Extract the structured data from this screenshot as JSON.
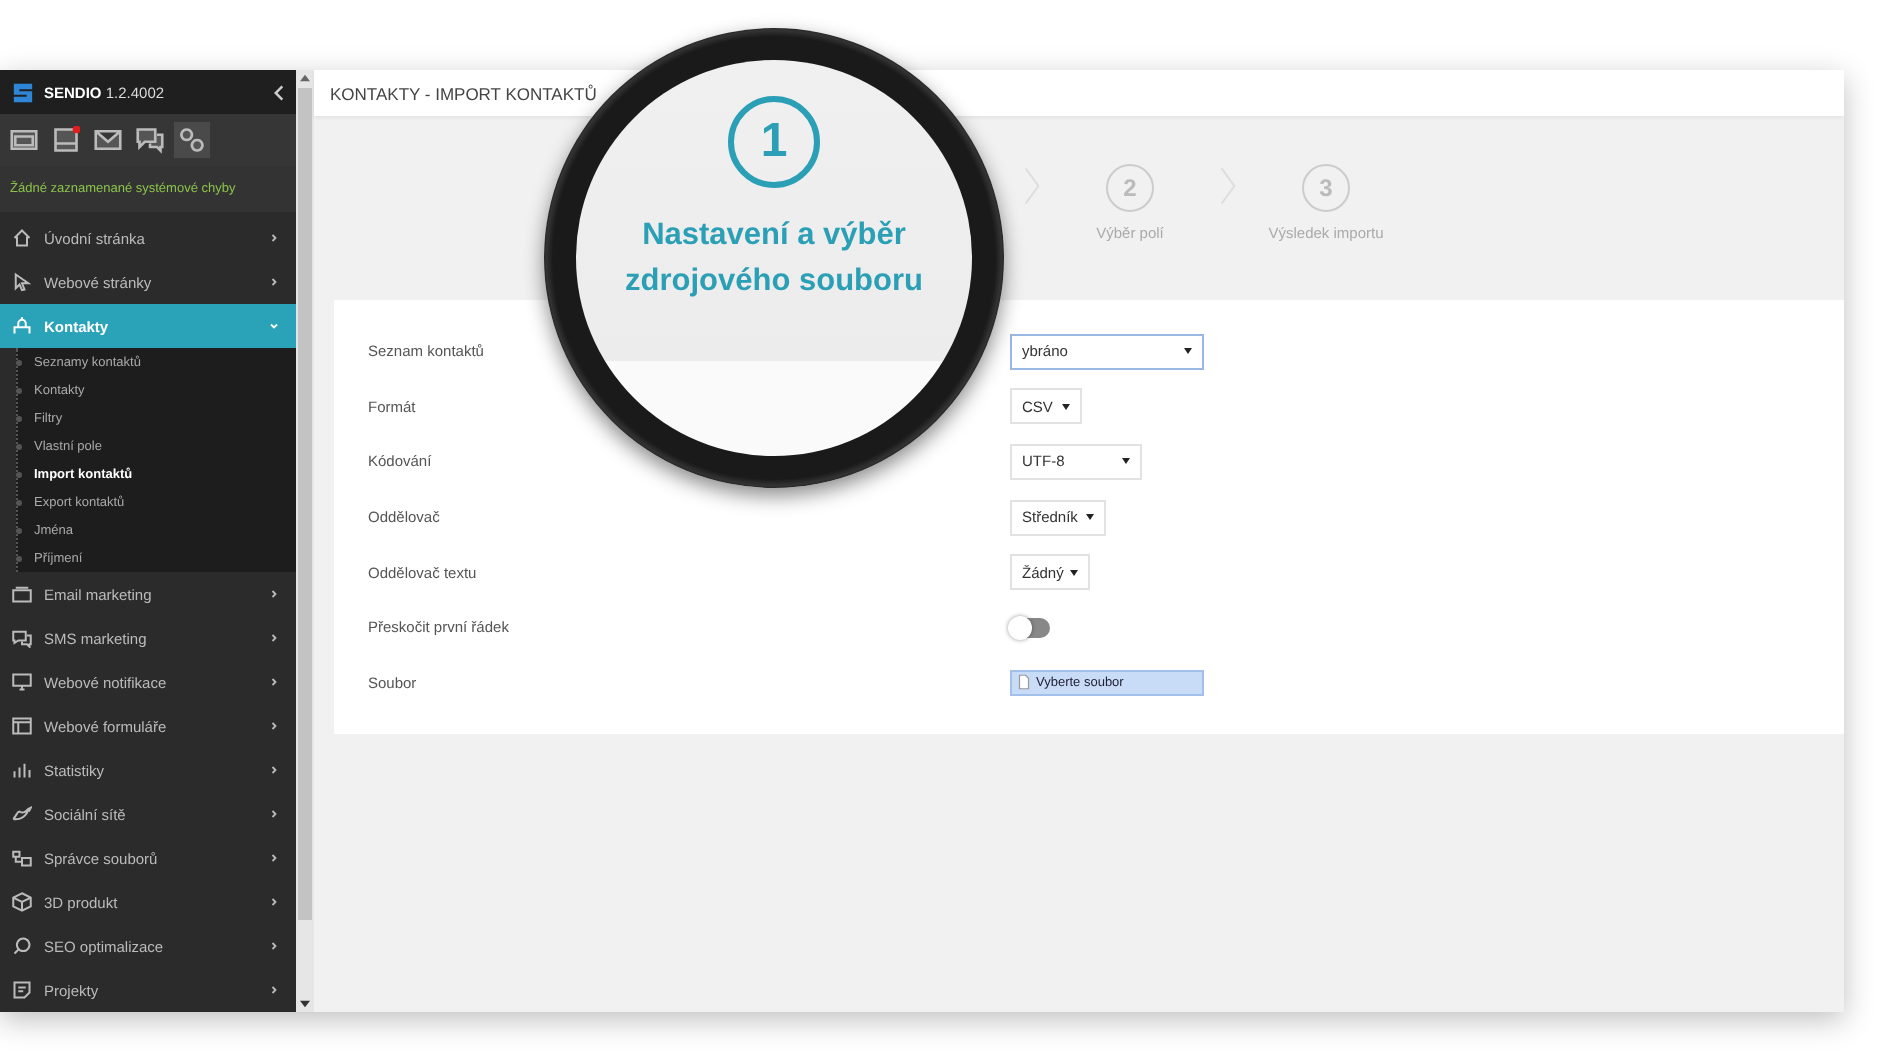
{
  "sidebar": {
    "brand": {
      "name": "SENDIO",
      "version": "1.2.4002"
    },
    "toolbar": [
      {
        "badge": false,
        "selected": false
      },
      {
        "badge": true,
        "selected": false
      },
      {
        "badge": false,
        "selected": false
      },
      {
        "badge": false,
        "selected": false
      },
      {
        "badge": false,
        "selected": true
      }
    ],
    "status": "Žádné zaznamenané systémové chyby",
    "menu": [
      {
        "label": "Úvodní stránka",
        "selected": false,
        "expanded": false
      },
      {
        "label": "Webové stránky",
        "selected": false,
        "expanded": false
      },
      {
        "label": "Kontakty",
        "selected": true,
        "expanded": true,
        "children": [
          {
            "label": "Seznamy kontaktů",
            "selected": false
          },
          {
            "label": "Kontakty",
            "selected": false
          },
          {
            "label": "Filtry",
            "selected": false
          },
          {
            "label": "Vlastní pole",
            "selected": false
          },
          {
            "label": "Import kontaktů",
            "selected": true
          },
          {
            "label": "Export kontaktů",
            "selected": false
          },
          {
            "label": "Jména",
            "selected": false
          },
          {
            "label": "Příjmení",
            "selected": false
          }
        ]
      },
      {
        "label": "Email marketing",
        "selected": false,
        "expanded": false
      },
      {
        "label": "SMS marketing",
        "selected": false,
        "expanded": false
      },
      {
        "label": "Webové notifikace",
        "selected": false,
        "expanded": false
      },
      {
        "label": "Webové formuláře",
        "selected": false,
        "expanded": false
      },
      {
        "label": "Statistiky",
        "selected": false,
        "expanded": false
      },
      {
        "label": "Sociální sítě",
        "selected": false,
        "expanded": false
      },
      {
        "label": "Správce souborů",
        "selected": false,
        "expanded": false
      },
      {
        "label": "3D produkt",
        "selected": false,
        "expanded": false
      },
      {
        "label": "SEO optimalizace",
        "selected": false,
        "expanded": false
      },
      {
        "label": "Projekty",
        "selected": false,
        "expanded": false
      }
    ]
  },
  "page": {
    "title": "KONTAKTY - IMPORT KONTAKTŮ",
    "steps": [
      {
        "number": "1",
        "label": "Nastavení a výběr zdrojového souboru",
        "selected": true
      },
      {
        "number": "2",
        "label": "Výběr polí",
        "selected": false
      },
      {
        "number": "3",
        "label": "Výsledek importu",
        "selected": false
      }
    ],
    "form": [
      {
        "label": "Seznam kontaktů",
        "kind": "select",
        "value": "ybráno",
        "focused": true
      },
      {
        "label": "Formát",
        "kind": "select",
        "value": "CSV",
        "focused": false
      },
      {
        "label": "Kódování",
        "kind": "select",
        "value": "UTF-8",
        "focused": false
      },
      {
        "label": "Oddělovač",
        "kind": "select",
        "value": "Středník",
        "focused": false
      },
      {
        "label": "Oddělovač textu",
        "kind": "select",
        "value": "Žádný",
        "focused": false
      },
      {
        "label": "Přeskočit první řádek",
        "kind": "toggle",
        "on": false
      },
      {
        "label": "Soubor",
        "kind": "file",
        "value": "Vyberte soubor"
      }
    ]
  }
}
